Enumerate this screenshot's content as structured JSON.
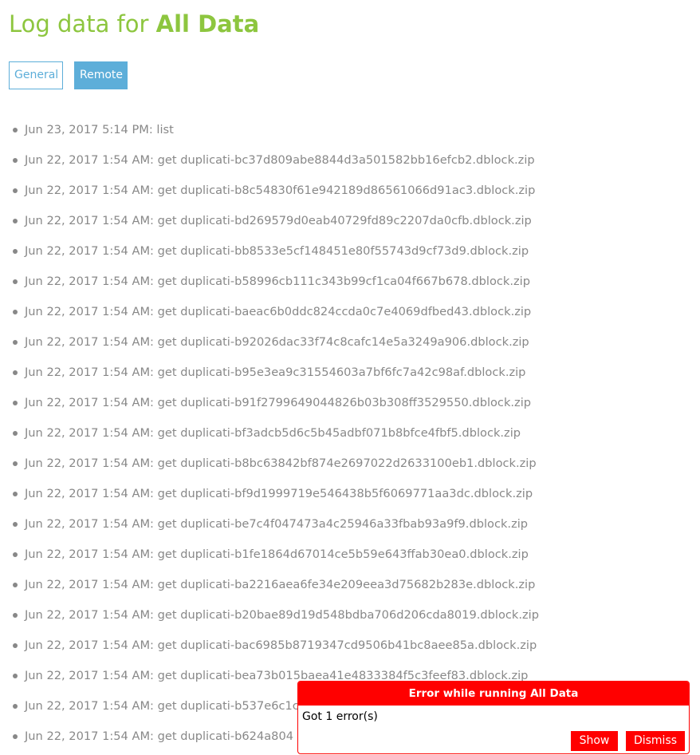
{
  "page": {
    "title_prefix": "Log data for ",
    "title_name": "All Data"
  },
  "tabs": {
    "general": "General",
    "remote": "Remote"
  },
  "log_entries": [
    "Jun 23, 2017 5:14 PM: list",
    "Jun 22, 2017 1:54 AM: get duplicati-bc37d809abe8844d3a501582bb16efcb2.dblock.zip",
    "Jun 22, 2017 1:54 AM: get duplicati-b8c54830f61e942189d86561066d91ac3.dblock.zip",
    "Jun 22, 2017 1:54 AM: get duplicati-bd269579d0eab40729fd89c2207da0cfb.dblock.zip",
    "Jun 22, 2017 1:54 AM: get duplicati-bb8533e5cf148451e80f55743d9cf73d9.dblock.zip",
    "Jun 22, 2017 1:54 AM: get duplicati-b58996cb111c343b99cf1ca04f667b678.dblock.zip",
    "Jun 22, 2017 1:54 AM: get duplicati-baeac6b0ddc824ccda0c7e4069dfbed43.dblock.zip",
    "Jun 22, 2017 1:54 AM: get duplicati-b92026dac33f74c8cafc14e5a3249a906.dblock.zip",
    "Jun 22, 2017 1:54 AM: get duplicati-b95e3ea9c31554603a7bf6fc7a42c98af.dblock.zip",
    "Jun 22, 2017 1:54 AM: get duplicati-b91f2799649044826b03b308ff3529550.dblock.zip",
    "Jun 22, 2017 1:54 AM: get duplicati-bf3adcb5d6c5b45adbf071b8bfce4fbf5.dblock.zip",
    "Jun 22, 2017 1:54 AM: get duplicati-b8bc63842bf874e2697022d2633100eb1.dblock.zip",
    "Jun 22, 2017 1:54 AM: get duplicati-bf9d1999719e546438b5f6069771aa3dc.dblock.zip",
    "Jun 22, 2017 1:54 AM: get duplicati-be7c4f047473a4c25946a33fbab93a9f9.dblock.zip",
    "Jun 22, 2017 1:54 AM: get duplicati-b1fe1864d67014ce5b59e643ffab30ea0.dblock.zip",
    "Jun 22, 2017 1:54 AM: get duplicati-ba2216aea6fe34e209eea3d75682b283e.dblock.zip",
    "Jun 22, 2017 1:54 AM: get duplicati-b20bae89d19d548bdba706d206cda8019.dblock.zip",
    "Jun 22, 2017 1:54 AM: get duplicati-bac6985b8719347cd9506b41bc8aee85a.dblock.zip",
    "Jun 22, 2017 1:54 AM: get duplicati-bea73b015baea41e4833384f5c3feef83.dblock.zip",
    "Jun 22, 2017 1:54 AM: get duplicati-b537e6c1c",
    "Jun 22, 2017 1:54 AM: get duplicati-b624a804"
  ],
  "toast": {
    "title": "Error while running All Data",
    "message": "Got 1 error(s)",
    "show_label": "Show",
    "dismiss_label": "Dismiss"
  },
  "colors": {
    "title_green": "#8dc63f",
    "tab_blue": "#5daed9",
    "log_text_gray": "#888888",
    "error_red": "#ff0000"
  }
}
